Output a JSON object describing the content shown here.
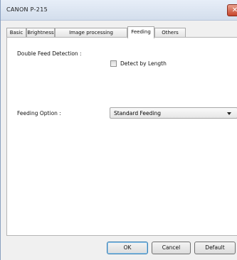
{
  "window": {
    "title": "CANON  P-215",
    "close_icon": "close-icon"
  },
  "tabs": [
    {
      "label": "Basic"
    },
    {
      "label": "Brightness"
    },
    {
      "label": "Image processing"
    },
    {
      "label": "Feeding",
      "active": true
    },
    {
      "label": "Others"
    }
  ],
  "feeding": {
    "double_feed_label": "Double Feed Detection :",
    "detect_by_length_label": "Detect by Length",
    "detect_by_length_checked": false,
    "feeding_option_label": "Feeding Option :",
    "feeding_option_value": "Standard Feeding"
  },
  "buttons": {
    "ok": "OK",
    "cancel": "Cancel",
    "default": "Default"
  },
  "colors": {
    "title_bar": "#dce6f2",
    "close_button": "#c6452b",
    "panel_bg": "#ffffff"
  }
}
